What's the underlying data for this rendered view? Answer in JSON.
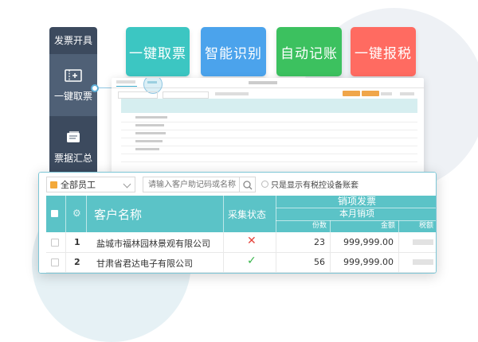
{
  "sidebar": {
    "title": "发票开具",
    "items": [
      {
        "label": "一键取票",
        "active": true,
        "icon": "ticket-icon"
      },
      {
        "label": "票据汇总",
        "active": false,
        "icon": "receipt-icon"
      }
    ]
  },
  "tiles": [
    {
      "label": "一键取票",
      "color": "#3cc6c2"
    },
    {
      "label": "智能识别",
      "color": "#4ba3ec"
    },
    {
      "label": "自动记账",
      "color": "#3cc15f"
    },
    {
      "label": "一键报税",
      "color": "#ff6b61"
    }
  ],
  "table": {
    "filter": {
      "value": "全部员工"
    },
    "search": {
      "placeholder": "请输入客户助记码或名称"
    },
    "only_tax_devices_label": "只是显示有税控设备账套",
    "headers": {
      "customer_name": "客户名称",
      "status": "采集状态",
      "group": "销项发票",
      "sub_group": "本月销项",
      "count": "份数",
      "amount": "金额",
      "tax": "税额"
    },
    "rows": [
      {
        "index": "1",
        "name": "盐城市福林园林景观有限公司",
        "status": "✕",
        "status_color": "#e5443c",
        "count": "23",
        "amount": "999,999.00"
      },
      {
        "index": "2",
        "name": "甘肃省君达电子有限公司",
        "status": "✓",
        "status_color": "#38b54a",
        "count": "56",
        "amount": "999,999.00"
      }
    ]
  },
  "colors": {
    "sidebar": "#3c4a5e",
    "header_teal": "#5bc3c7"
  }
}
